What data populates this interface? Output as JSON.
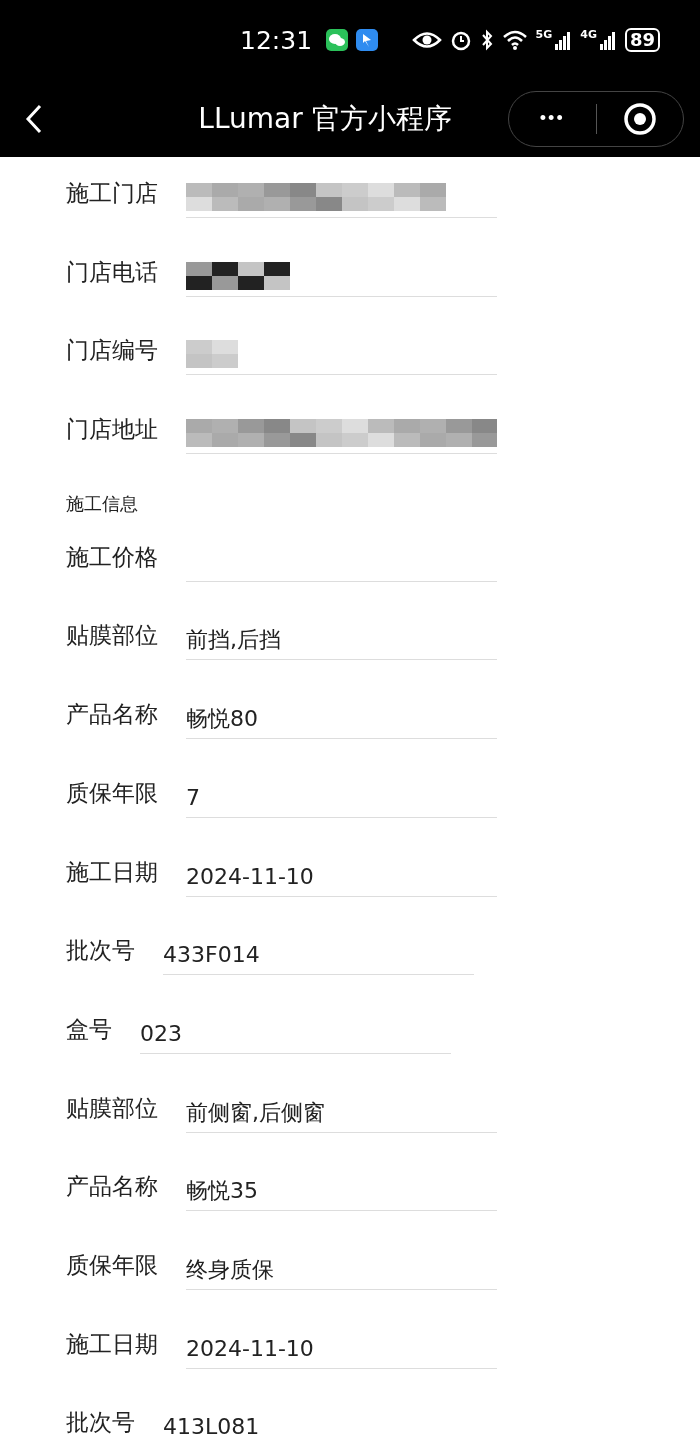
{
  "status_bar": {
    "time": "12:31",
    "network_1": "5G",
    "network_2": "4G",
    "battery": "89"
  },
  "nav_bar": {
    "title": "LLumar 官方小程序",
    "more_button": "•••"
  },
  "sections": [
    {
      "items": [
        {
          "label": "施工门店",
          "redacted": true
        },
        {
          "label": "门店电话",
          "redacted": true
        },
        {
          "label": "门店编号",
          "redacted": true
        },
        {
          "label": "门店地址",
          "redacted": true
        }
      ]
    },
    {
      "heading": "施工信息",
      "items": [
        {
          "label": "施工价格",
          "value": ""
        },
        {
          "label": "贴膜部位",
          "value": "前挡,后挡"
        },
        {
          "label": "产品名称",
          "value": "畅悦80"
        },
        {
          "label": "质保年限",
          "value": "7"
        },
        {
          "label": "施工日期",
          "value": "2024-11-10"
        },
        {
          "label": "批次号",
          "value": "433F014"
        },
        {
          "label": "盒号",
          "value": "023"
        },
        {
          "label": "贴膜部位",
          "value": "前侧窗,后侧窗"
        },
        {
          "label": "产品名称",
          "value": "畅悦35"
        },
        {
          "label": "质保年限",
          "value": "终身质保"
        },
        {
          "label": "施工日期",
          "value": "2024-11-10"
        },
        {
          "label": "批次号",
          "value": "413L081"
        }
      ]
    }
  ]
}
